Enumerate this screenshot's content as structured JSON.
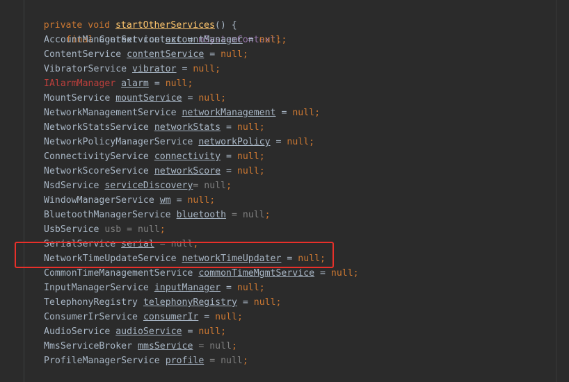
{
  "method": {
    "modifiers": "private void ",
    "name": "startOtherServices",
    "params": "() ",
    "brace": "{"
  },
  "context_line": {
    "keyword": "final ",
    "type": "Context",
    "name": " context",
    "op": " = ",
    "value": "mSystemContext",
    "semi": ";"
  },
  "declarations": [
    {
      "type": "AccountManagerService",
      "name": "accountManager",
      "op": " = ",
      "value": "null",
      "semi": ";"
    },
    {
      "type": "ContentService",
      "name": "contentService",
      "op": " = ",
      "value": "null",
      "semi": ";"
    },
    {
      "type": "VibratorService",
      "name": "vibrator",
      "op": " = ",
      "value": "null",
      "semi": ";"
    },
    {
      "type": "IAlarmManager",
      "name": "alarm",
      "op": " = ",
      "value": "null",
      "semi": ";"
    },
    {
      "type": "MountService",
      "name": "mountService",
      "op": " = ",
      "value": "null",
      "semi": ";"
    },
    {
      "type": "NetworkManagementService",
      "name": "networkManagement",
      "op": " = ",
      "value": "null",
      "semi": ";"
    },
    {
      "type": "NetworkStatsService",
      "name": "networkStats",
      "op": " = ",
      "value": "null",
      "semi": ";"
    },
    {
      "type": "NetworkPolicyManagerService",
      "name": "networkPolicy",
      "op": " = ",
      "value": "null",
      "semi": ";"
    },
    {
      "type": "ConnectivityService",
      "name": "connectivity",
      "op": " = ",
      "value": "null",
      "semi": ";"
    },
    {
      "type": "NetworkScoreService",
      "name": "networkScore",
      "op": " = ",
      "value": "null",
      "semi": ";"
    },
    {
      "type": "NsdService",
      "name": "serviceDiscovery",
      "op": "= ",
      "value": "null",
      "semi": ";"
    },
    {
      "type": "WindowManagerService",
      "name": "wm",
      "op": " = ",
      "value": "null",
      "semi": ";"
    },
    {
      "type": "BluetoothManagerService",
      "name": "bluetooth",
      "op": " = ",
      "value": "null",
      "semi": ";"
    },
    {
      "type": "UsbService",
      "name": "usb",
      "op": " = ",
      "value": "null",
      "semi": ";"
    },
    {
      "type": "SerialService",
      "name": "serial",
      "op": " = ",
      "value": "null",
      "semi": ";"
    },
    {
      "type": "NetworkTimeUpdateService",
      "name": "networkTimeUpdater",
      "op": " = ",
      "value": "null",
      "semi": ";"
    },
    {
      "type": "CommonTimeManagementService",
      "name": "commonTimeMgmtService",
      "op": " = ",
      "value": "null",
      "semi": ";"
    },
    {
      "type": "InputManagerService",
      "name": "inputManager",
      "op": " = ",
      "value": "null",
      "semi": ";"
    },
    {
      "type": "TelephonyRegistry",
      "name": "telephonyRegistry",
      "op": " = ",
      "value": "null",
      "semi": ";"
    },
    {
      "type": "ConsumerIrService",
      "name": "consumerIr",
      "op": " = ",
      "value": "null",
      "semi": ";"
    },
    {
      "type": "AudioService",
      "name": "audioService",
      "op": " = ",
      "value": "null",
      "semi": ";"
    },
    {
      "type": "MmsServiceBroker",
      "name": "mmsService",
      "op": " = ",
      "value": "null",
      "semi": ";"
    },
    {
      "type": "ProfileManagerService",
      "name": "profile",
      "op": " = ",
      "value": "null",
      "semi": ";"
    }
  ],
  "highlighted_line": "NetworkTimeUpdateService networkTimeUpdater = null;",
  "colors": {
    "background": "#2b2b2b",
    "keyword": "#cc7832",
    "method": "#ffc66d",
    "field": "#9876aa",
    "text": "#a9b7c6",
    "error": "#bc3f3c",
    "highlight_box": "#e8302a"
  }
}
